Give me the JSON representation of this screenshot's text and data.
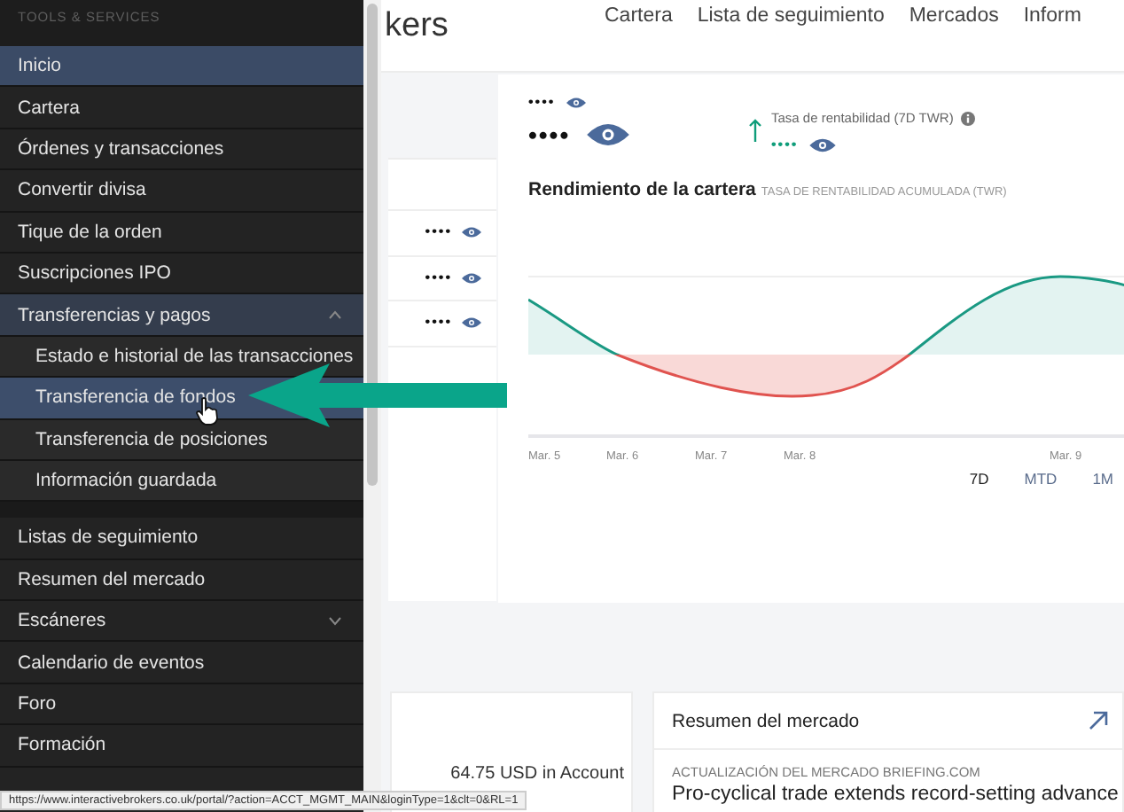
{
  "sidebar": {
    "heading": "TOOLS & SERVICES",
    "sections": [
      {
        "items": [
          {
            "label": "Inicio",
            "selected": true
          },
          {
            "label": "Cartera",
            "selected": false
          },
          {
            "label": "Órdenes y transacciones",
            "selected": false
          },
          {
            "label": "Convertir divisa",
            "selected": false
          },
          {
            "label": "Tique de la orden",
            "selected": false
          },
          {
            "label": "Suscripciones IPO",
            "selected": false
          },
          {
            "label": "Transferencias y pagos",
            "selected": false,
            "expanded": true,
            "children": [
              {
                "label": "Estado e historial de las transacciones",
                "selected": false
              },
              {
                "label": "Transferencia de fondos",
                "selected": true
              },
              {
                "label": "Transferencia de posiciones",
                "selected": false
              },
              {
                "label": "Información guardada",
                "selected": false
              }
            ]
          }
        ]
      },
      {
        "items": [
          {
            "label": "Listas de seguimiento",
            "selected": false
          },
          {
            "label": "Resumen del mercado",
            "selected": false
          },
          {
            "label": "Escáneres",
            "selected": false,
            "expanded": false
          },
          {
            "label": "Calendario de eventos",
            "selected": false
          },
          {
            "label": "Foro",
            "selected": false
          },
          {
            "label": "Formación",
            "selected": false
          }
        ]
      }
    ]
  },
  "header": {
    "logo_text": "kers",
    "nav": [
      "Cartera",
      "Lista de seguimiento",
      "Mercados",
      "Inform"
    ]
  },
  "balances": {
    "rows": [
      "••••",
      "••••",
      "••••"
    ]
  },
  "performance": {
    "value_small": "••••",
    "value_large": "••••",
    "return_label": "Tasa de rentabilidad (7D TWR)",
    "return_value": "••••",
    "title": "Rendimiento de la cartera",
    "subtitle": "TASA DE RENTABILIDAD ACUMULADA (TWR)",
    "x_labels": [
      "Mar. 5",
      "Mar. 6",
      "Mar. 7",
      "Mar. 8",
      "Mar. 9"
    ],
    "periods": [
      {
        "label": "7D",
        "selected": true
      },
      {
        "label": "MTD",
        "selected": false
      },
      {
        "label": "1M",
        "selected": false
      }
    ]
  },
  "account": {
    "text": "64.75 USD in Account"
  },
  "market": {
    "title": "Resumen del mercado",
    "source": "ACTUALIZACIÓN DEL MERCADO BRIEFING.COM",
    "headline": "Pro-cyclical trade extends record-setting advance"
  },
  "status_url": "https://www.interactivebrokers.co.uk/portal/?action=ACCT_MGMT_MAIN&loginType=1&clt=0&RL=1"
}
